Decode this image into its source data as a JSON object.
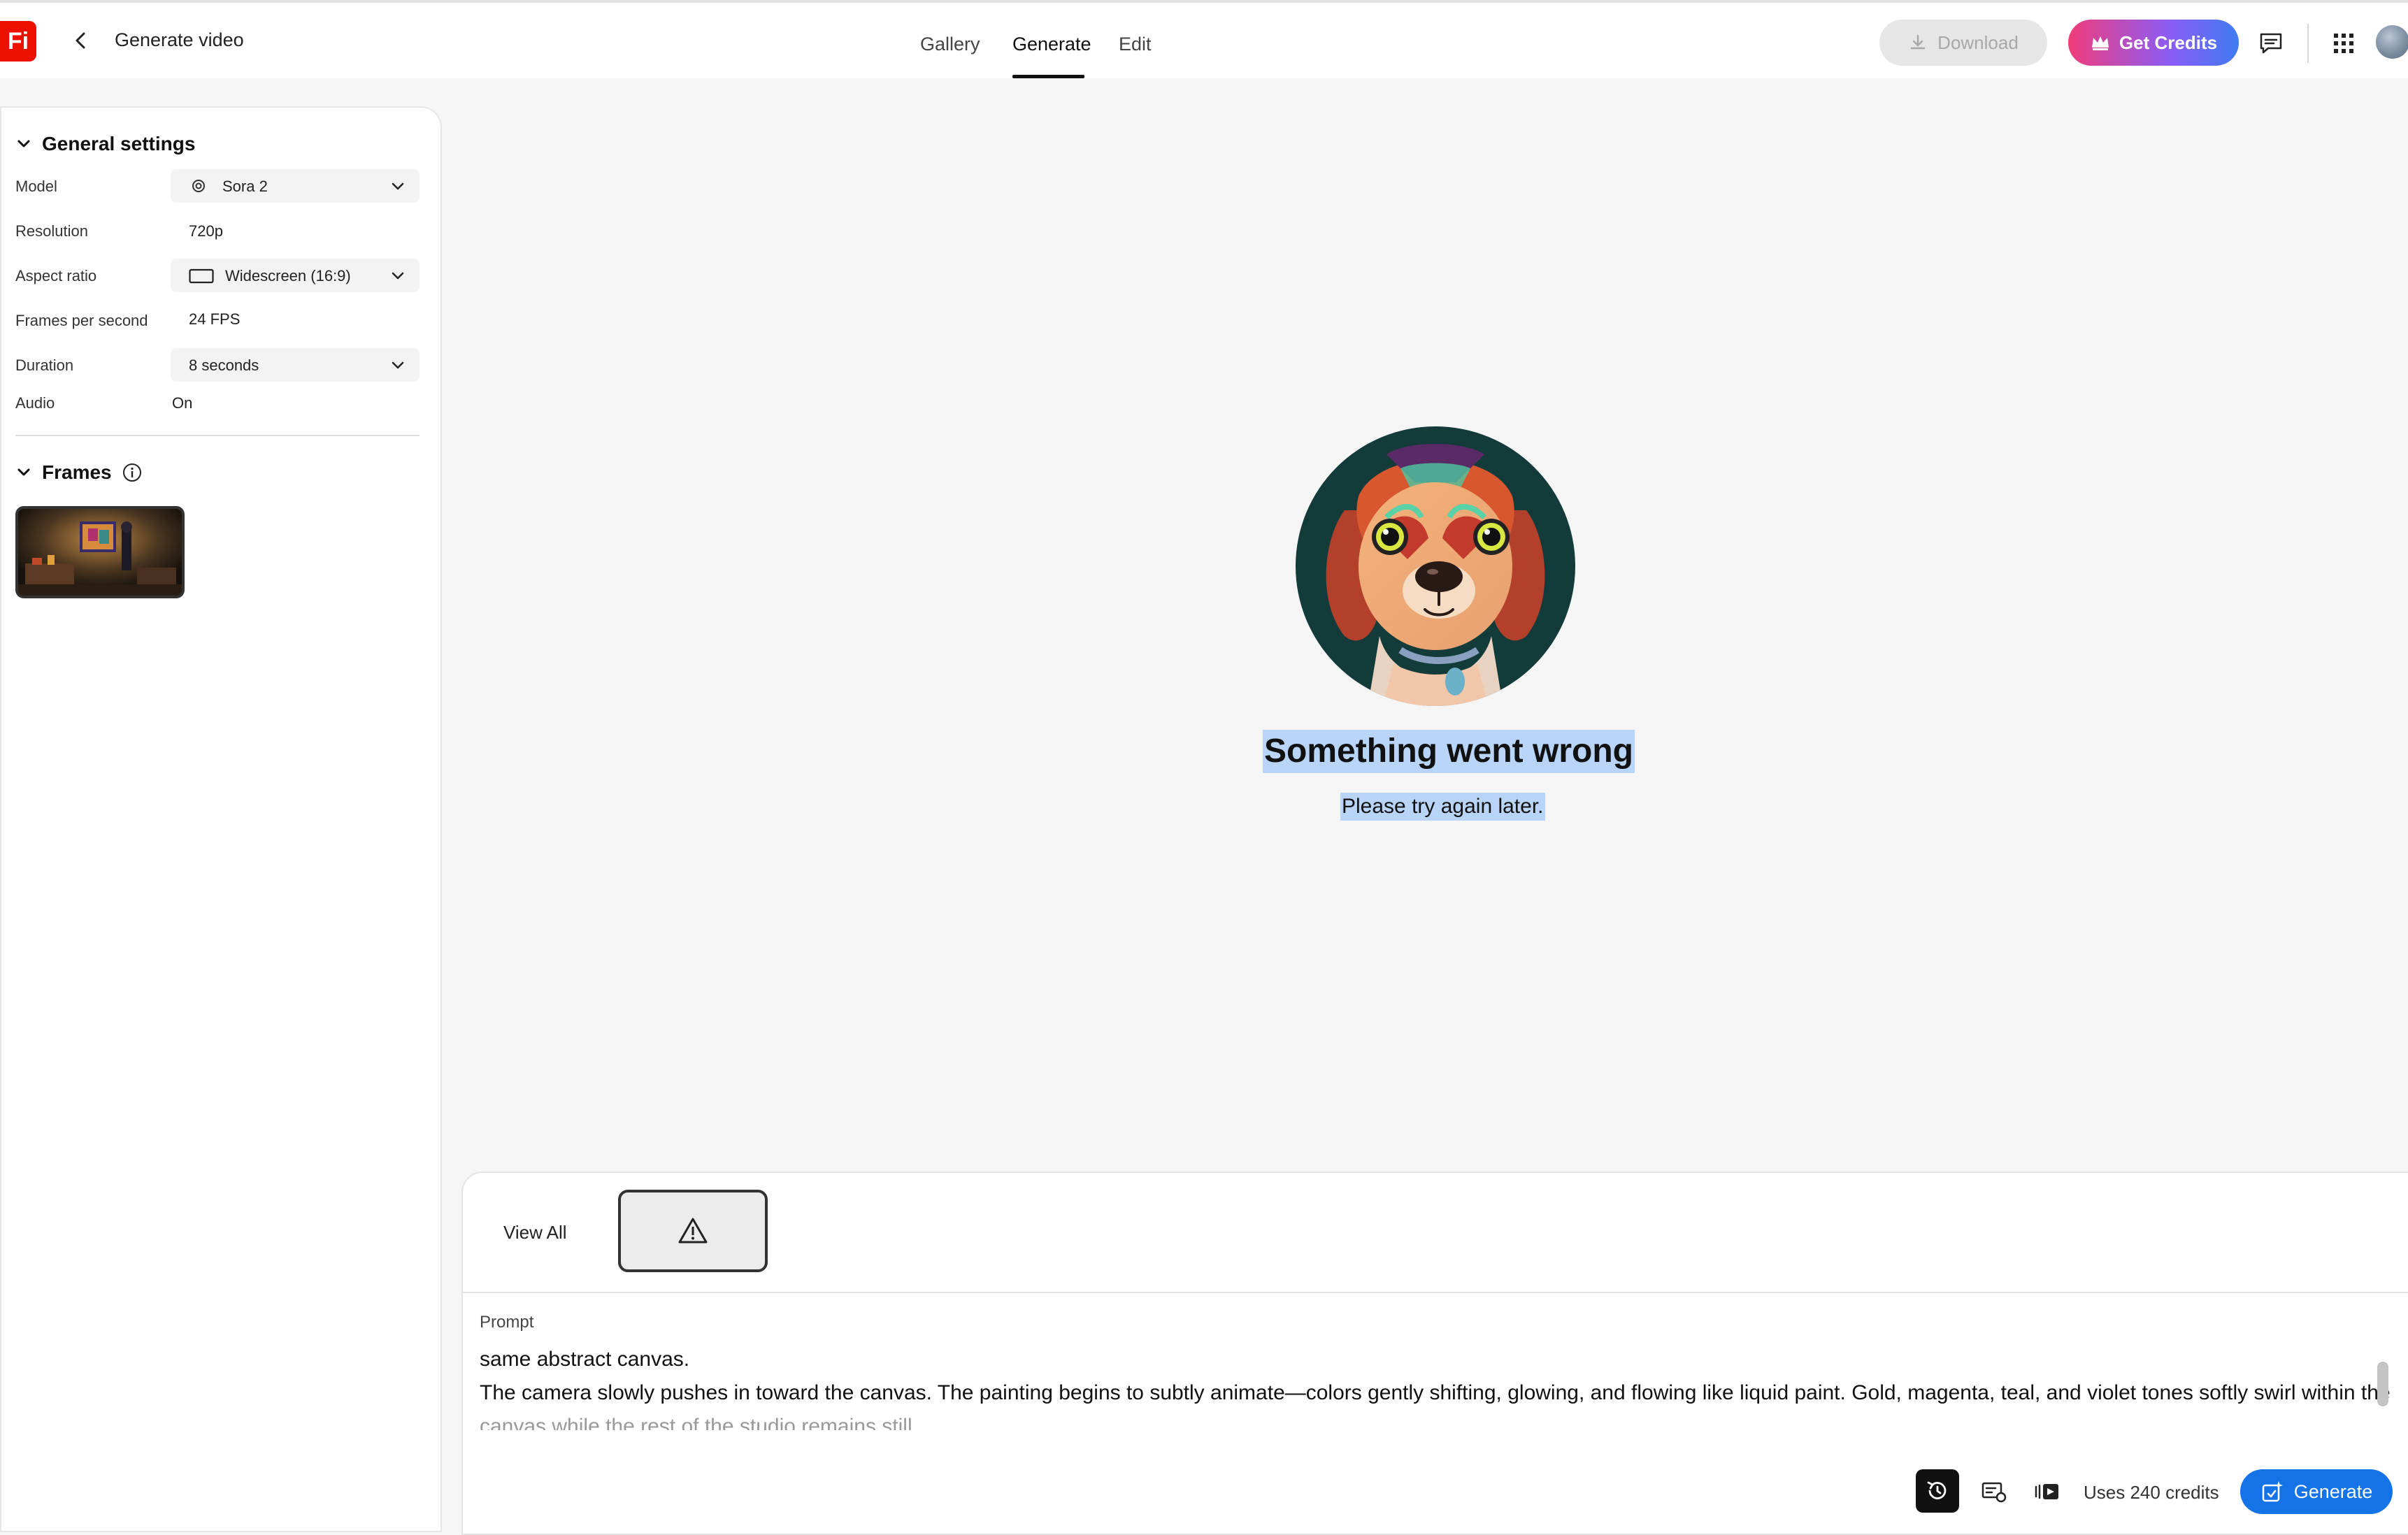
{
  "app": {
    "logo_text": "Fi",
    "title": "Generate video"
  },
  "tabs": [
    {
      "label": "Gallery",
      "active": false
    },
    {
      "label": "Generate",
      "active": true
    },
    {
      "label": "Edit",
      "active": false
    }
  ],
  "header": {
    "download_label": "Download",
    "credits_label": "Get Credits"
  },
  "general_settings": {
    "heading": "General settings",
    "model_label": "Model",
    "model_value": "Sora 2",
    "resolution_label": "Resolution",
    "resolution_value": "720p",
    "aspect_label": "Aspect ratio",
    "aspect_value": "Widescreen (16:9)",
    "fps_label": "Frames per second",
    "fps_value": "24 FPS",
    "duration_label": "Duration",
    "duration_value": "8 seconds",
    "audio_label": "Audio",
    "audio_value": "On"
  },
  "frames": {
    "heading": "Frames"
  },
  "error": {
    "title": "Something went wrong",
    "subtitle": "Please try again later."
  },
  "bottom": {
    "view_all": "View All",
    "prompt_label": "Prompt",
    "prompt_lines": [
      "same abstract canvas.",
      "The camera slowly pushes in toward the canvas. The painting begins to subtly animate—colors gently shifting, glowing, and flowing like liquid paint. Gold, magenta, teal, and violet tones softly swirl within the",
      "canvas while the rest of the studio remains still."
    ],
    "uses_credits": "Uses 240 credits",
    "generate_label": "Generate"
  },
  "colors": {
    "accent": "#1473e6",
    "logo": "#eb1000",
    "selection": "#b8d4f6"
  }
}
